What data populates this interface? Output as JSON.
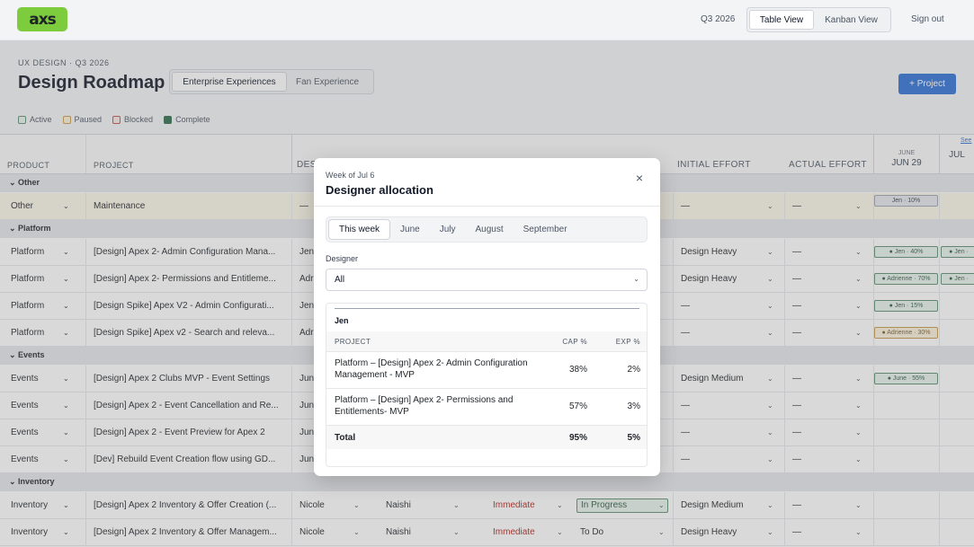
{
  "app": {
    "logo_text": "axs",
    "quarter": "Q3 2026",
    "view_tabs": [
      "Table View",
      "Kanban View"
    ],
    "sign_out": "Sign out"
  },
  "header": {
    "eyebrow": "UX DESIGN · Q3 2026",
    "title": "Design Roadmap",
    "segments": [
      "Enterprise Experiences",
      "Fan Experience"
    ],
    "add_button": "+ Project"
  },
  "legend": [
    {
      "label": "Active",
      "color": "#5a8c6e",
      "fill": "#e8f3ec"
    },
    {
      "label": "Paused",
      "color": "#c79a45",
      "fill": "#fbf1dc"
    },
    {
      "label": "Blocked",
      "color": "#c0504d",
      "fill": "#fbe7e6"
    },
    {
      "label": "Complete",
      "color": "#2e6b4c",
      "fill": "#2e6b4c"
    }
  ],
  "columns": {
    "product": "PRODUCT",
    "project": "PROJECT",
    "designer": "DES",
    "initial_effort": "INITIAL EFFORT",
    "actual_effort": "ACTUAL EFFORT",
    "see_link": "See",
    "weeks": [
      {
        "month": "JUNE",
        "day": "JUN 29"
      },
      {
        "month": "",
        "day": "JUL"
      }
    ]
  },
  "rows": [
    {
      "group": "Other"
    },
    {
      "product": "Other",
      "project": "Maintenance",
      "designer": "—",
      "initial": "—",
      "actual": "—",
      "pills": [
        {
          "text": "Jen · 10%",
          "kind": "grey"
        }
      ]
    },
    {
      "group": "Platform"
    },
    {
      "product": "Platform",
      "project": "[Design] Apex 2- Admin Configuration Mana...",
      "designer": "Jen",
      "initial": "Design Heavy",
      "actual": "—",
      "pills": [
        {
          "text": "● Jen · 40%",
          "kind": "green"
        },
        {
          "text": "● Jen ·",
          "kind": "green"
        }
      ]
    },
    {
      "product": "Platform",
      "project": "[Design] Apex 2- Permissions and Entitleme...",
      "designer": "Adr",
      "initial": "Design Heavy",
      "actual": "—",
      "pills": [
        {
          "text": "● Adrienne · 70%",
          "kind": "green"
        },
        {
          "text": "● Jen ·",
          "kind": "green"
        }
      ]
    },
    {
      "product": "Platform",
      "project": "[Design Spike] Apex V2 - Admin Configurati...",
      "designer": "Jen",
      "initial": "—",
      "actual": "—",
      "pills": [
        {
          "text": "● Jen · 15%",
          "kind": "green"
        }
      ]
    },
    {
      "product": "Platform",
      "project": "[Design Spike] Apex v2 - Search and releva...",
      "designer": "Adr",
      "initial": "—",
      "actual": "—",
      "pills": [
        {
          "text": "● Adrienne · 30%",
          "kind": "amber"
        }
      ]
    },
    {
      "group": "Events"
    },
    {
      "product": "Events",
      "project": "[Design] Apex 2 Clubs MVP - Event Settings",
      "designer": "Jun",
      "initial": "Design Medium",
      "actual": "—",
      "pills": [
        {
          "text": "● June · 55%",
          "kind": "green"
        }
      ]
    },
    {
      "product": "Events",
      "project": "[Design] Apex 2 - Event Cancellation and Re...",
      "designer": "Jun",
      "initial": "—",
      "actual": "—",
      "pills": []
    },
    {
      "product": "Events",
      "project": "[Design] Apex 2 - Event Preview for Apex 2",
      "designer": "Jun",
      "initial": "—",
      "actual": "—",
      "pills": []
    },
    {
      "product": "Events",
      "project": "[Dev] Rebuild Event Creation flow using GD...",
      "designer": "Jun",
      "initial": "—",
      "actual": "—",
      "pills": []
    },
    {
      "group": "Inventory"
    },
    {
      "product": "Inventory",
      "project": "[Design] Apex 2 Inventory & Offer Creation (...",
      "designer": "Nicole",
      "pm": "Naishi",
      "priority": "Immediate",
      "status": "In Progress",
      "initial": "Design Medium",
      "actual": "—",
      "pills": []
    },
    {
      "product": "Inventory",
      "project": "[Design] Apex 2 Inventory & Offer Managem...",
      "designer": "Nicole",
      "pm": "Naishi",
      "priority": "Immediate",
      "status": "To Do",
      "initial": "Design Heavy",
      "actual": "—",
      "pills": []
    }
  ],
  "modal": {
    "subtitle": "Week of Jul 6",
    "title": "Designer allocation",
    "close": "×",
    "tabs": [
      "This week",
      "June",
      "July",
      "August",
      "September"
    ],
    "designer_label": "Designer",
    "designer_value": "All",
    "person": "Jen",
    "table_headers": {
      "project": "PROJECT",
      "cap": "CAP %",
      "exp": "EXP %"
    },
    "table_rows": [
      {
        "project": "Platform – [Design] Apex 2- Admin Configuration Management - MVP",
        "cap": "38%",
        "exp": "2%"
      },
      {
        "project": "Platform – [Design] Apex 2- Permissions and Entitlements- MVP",
        "cap": "57%",
        "exp": "3%"
      }
    ],
    "total": {
      "label": "Total",
      "cap": "95%",
      "exp": "5%"
    }
  }
}
